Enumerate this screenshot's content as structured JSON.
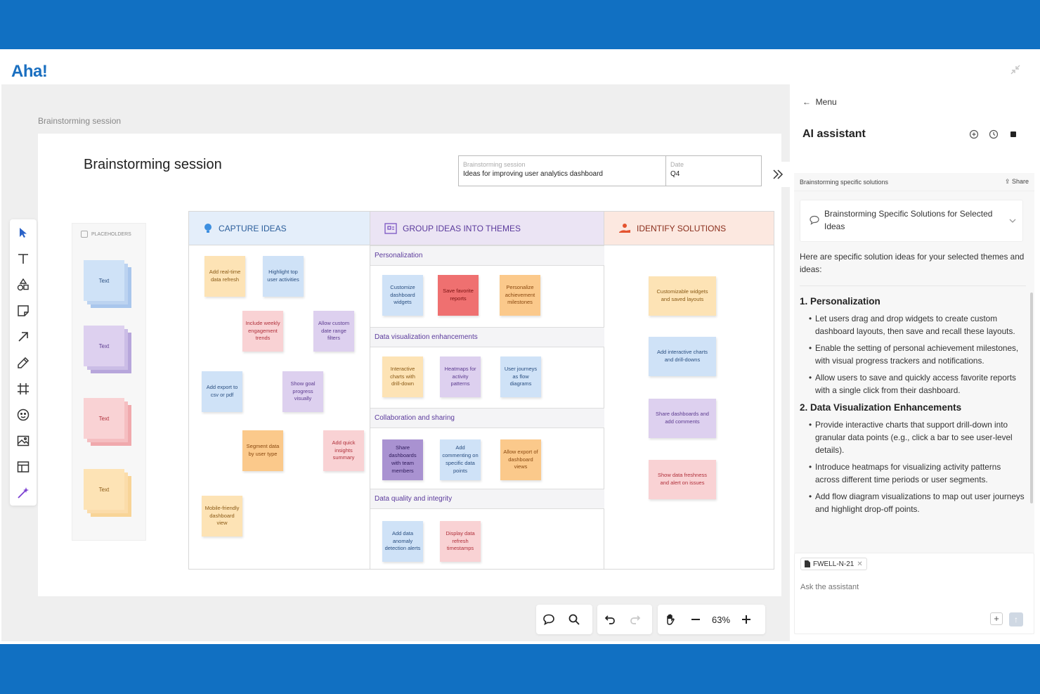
{
  "app": {
    "logo": "Aha!"
  },
  "canvas": {
    "breadcrumb": "Brainstorming session",
    "board_title": "Brainstorming session",
    "info": {
      "session_label": "Brainstorming session",
      "session_value": "Ideas for improving user analytics dashboard",
      "date_label": "Date",
      "date_value": "Q4"
    },
    "placeholders": {
      "title": "PLACEHOLDERS",
      "items": [
        {
          "label": "Text",
          "color": "blue"
        },
        {
          "label": "Text",
          "color": "purple"
        },
        {
          "label": "Text",
          "color": "pink"
        },
        {
          "label": "Text",
          "color": "yellow"
        }
      ]
    },
    "columns": {
      "capture": "CAPTURE IDEAS",
      "group": "GROUP IDEAS INTO THEMES",
      "identify": "IDENTIFY SOLUTIONS"
    },
    "capture_notes": [
      "Add real-time data refresh",
      "Highlight top user activities",
      "Include weekly engagement trends",
      "Allow custom date range filters",
      "Add export to csv or pdf",
      "Show goal progress visually",
      "Segment data by user type",
      "Add quick insights summary",
      "Mobile-friendly dashboard view"
    ],
    "themes": [
      {
        "title": "Personalization",
        "notes": [
          "Customize dashboard widgets",
          "Save favorite reports",
          "Personalize achievement milestones"
        ]
      },
      {
        "title": "Data visualization enhancements",
        "notes": [
          "Interactive charts with drill-down",
          "Heatmaps for activity patterns",
          "User journeys as flow diagrams"
        ]
      },
      {
        "title": "Collaboration and sharing",
        "notes": [
          "Share dashboards with team members",
          "Add commenting on specific data points",
          "Allow export of dashboard views"
        ]
      },
      {
        "title": "Data quality and integrity",
        "notes": [
          "Add data anomaly detection alerts",
          "Display data refresh timestamps"
        ]
      }
    ],
    "solutions": [
      "Customizable widgets and saved layouts",
      "Add interactive charts and drill-downs",
      "Share dashboards and add comments",
      "Show data freshness and alert on issues"
    ],
    "zoom": "63%"
  },
  "assistant": {
    "menu": "Menu",
    "title": "AI assistant",
    "conversation_title": "Brainstorming specific solutions",
    "share": "Share",
    "selected_prompt": "Brainstorming Specific Solutions for Selected Ideas",
    "intro": "Here are specific solution ideas for your selected themes and ideas:",
    "sections": [
      {
        "heading": "1. Personalization",
        "bullets": [
          "Let users drag and drop widgets to create custom dashboard layouts, then save and recall these layouts.",
          "Enable the setting of personal achievement milestones, with visual progress trackers and notifications.",
          "Allow users to save and quickly access favorite reports with a single click from their dashboard."
        ]
      },
      {
        "heading": "2. Data Visualization Enhancements",
        "bullets": [
          "Provide interactive charts that support drill-down into granular data points (e.g., click a bar to see user-level details).",
          "Introduce heatmaps for visualizing activity patterns across different time periods or user segments.",
          "Add flow diagram visualizations to map out user journeys and highlight drop-off points."
        ]
      }
    ],
    "chip": "FWELL-N-21",
    "input_placeholder": "Ask the assistant"
  }
}
